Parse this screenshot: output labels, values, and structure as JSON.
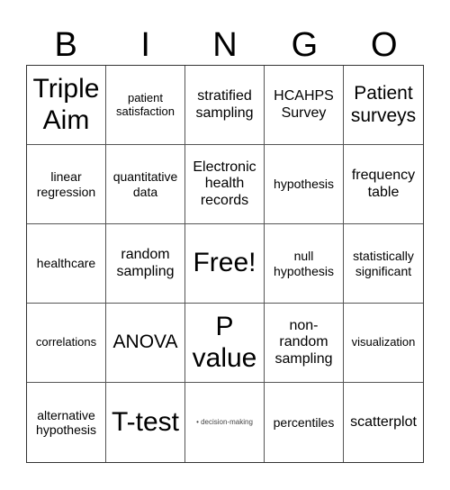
{
  "header": {
    "letters": [
      "B",
      "I",
      "N",
      "G",
      "O"
    ]
  },
  "cells": [
    {
      "text": "Triple Aim",
      "size": "s-xl"
    },
    {
      "text": "patient satisfaction",
      "size": "s-xs"
    },
    {
      "text": "stratified sampling",
      "size": "s-md"
    },
    {
      "text": "HCAHPS Survey",
      "size": "s-md"
    },
    {
      "text": "Patient surveys",
      "size": "s-lg"
    },
    {
      "text": "linear regression",
      "size": "s-sm"
    },
    {
      "text": "quantitative data",
      "size": "s-sm"
    },
    {
      "text": "Electronic health records",
      "size": "s-md"
    },
    {
      "text": "hypothesis",
      "size": "s-sm"
    },
    {
      "text": "frequency table",
      "size": "s-md"
    },
    {
      "text": "healthcare",
      "size": "s-sm"
    },
    {
      "text": "random sampling",
      "size": "s-md"
    },
    {
      "text": "Free!",
      "size": "s-xl"
    },
    {
      "text": "null hypothesis",
      "size": "s-sm"
    },
    {
      "text": "statistically significant",
      "size": "s-sm"
    },
    {
      "text": "correlations",
      "size": "s-xs"
    },
    {
      "text": "ANOVA",
      "size": "s-lg"
    },
    {
      "text": "P value",
      "size": "s-xl"
    },
    {
      "text": "non-random sampling",
      "size": "s-md"
    },
    {
      "text": "visualization",
      "size": "s-xs"
    },
    {
      "text": "alternative hypothesis",
      "size": "s-sm"
    },
    {
      "text": "T-test",
      "size": "s-xl"
    },
    {
      "text": "• decision-making",
      "size": "s-tiny"
    },
    {
      "text": "percentiles",
      "size": "s-sm"
    },
    {
      "text": "scatterplot",
      "size": "s-md"
    }
  ]
}
